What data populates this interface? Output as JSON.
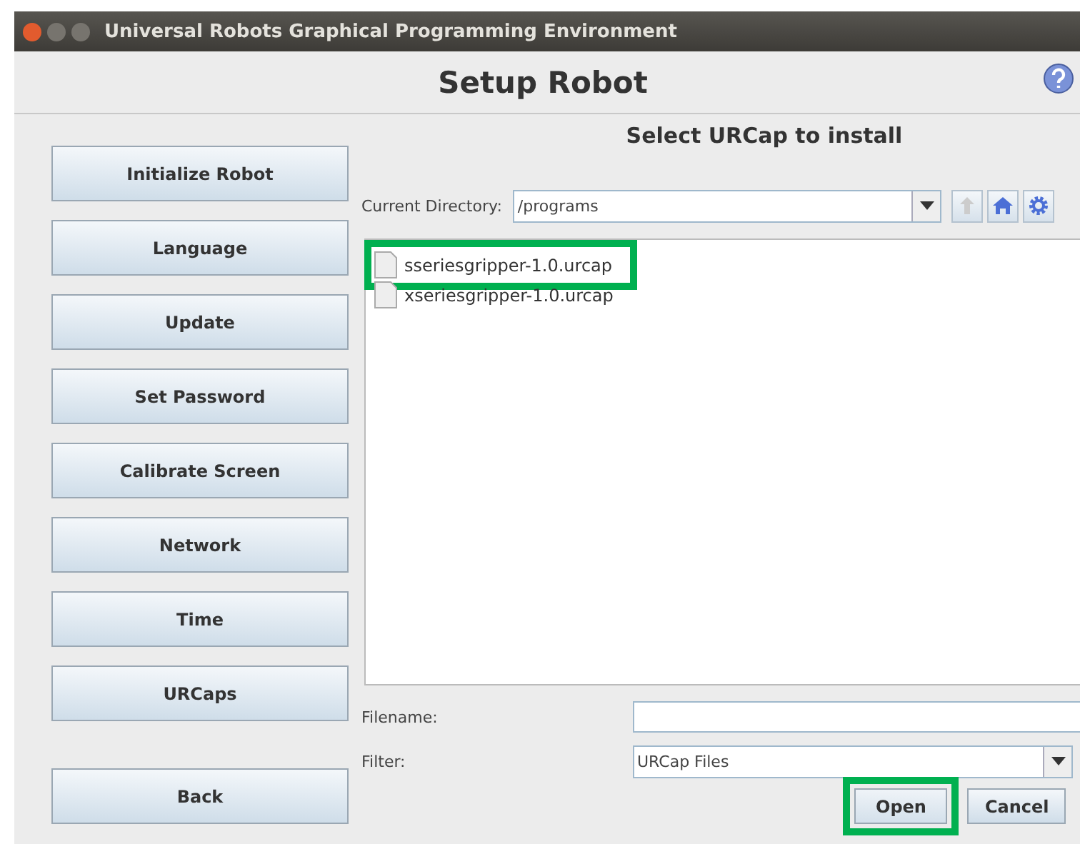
{
  "window": {
    "title": "Universal Robots Graphical Programming Environment"
  },
  "heading": "Setup Robot",
  "sidebar": {
    "buttons": [
      {
        "label": "Initialize Robot"
      },
      {
        "label": "Language"
      },
      {
        "label": "Update"
      },
      {
        "label": "Set Password"
      },
      {
        "label": "Calibrate Screen"
      },
      {
        "label": "Network"
      },
      {
        "label": "Time"
      },
      {
        "label": "URCaps"
      }
    ],
    "back": "Back"
  },
  "chooser": {
    "title": "Select URCap to install",
    "directory_label": "Current Directory:",
    "directory": "/programs",
    "files": [
      {
        "name": "sseriesgripper-1.0.urcap",
        "highlighted": true
      },
      {
        "name": "xseriesgripper-1.0.urcap",
        "highlighted": false
      }
    ],
    "filename_label": "Filename:",
    "filter_label": "Filter:",
    "filter": "URCap Files",
    "buttons": [
      {
        "label": "Open",
        "highlighted": true
      },
      {
        "label": "Cancel",
        "highlighted": false
      }
    ]
  }
}
